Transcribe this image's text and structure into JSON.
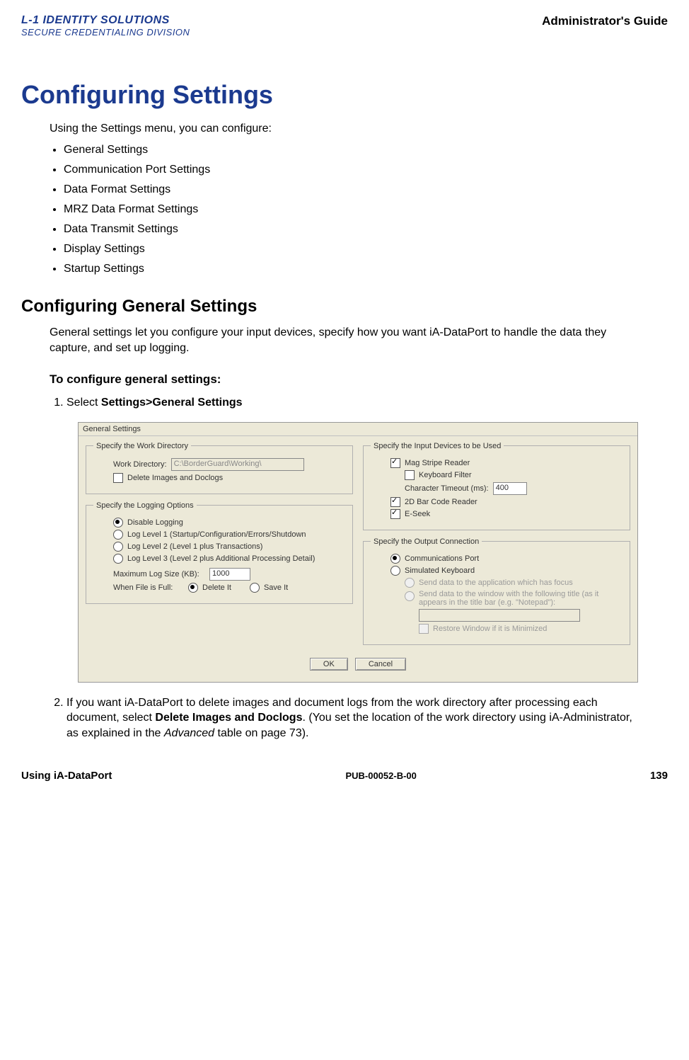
{
  "header": {
    "logo_line1": "L-1 IDENTITY SOLUTIONS",
    "logo_line2": "SECURE CREDENTIALING DIVISION",
    "guide": "Administrator's Guide"
  },
  "h1": "Configuring Settings",
  "intro": "Using the Settings menu, you can configure:",
  "bullets": [
    "General Settings",
    "Communication Port Settings",
    "Data Format Settings",
    "MRZ Data Format Settings",
    "Data Transmit Settings",
    "Display Settings",
    "Startup Settings"
  ],
  "h2": "Configuring General Settings",
  "para1": "General settings let you configure your input devices, specify how you want iA-DataPort to handle the data they capture, and set up logging.",
  "sub3": "To configure general settings:",
  "step1_pre": "Select ",
  "step1_bold": "Settings>General Settings",
  "step2_a": "If you want iA-DataPort to delete images and document logs from the work directory after processing each document, select ",
  "step2_bold": "Delete Images and Doclogs",
  "step2_b": ". (You set the location of the work directory using iA-Administrator, as explained in the ",
  "step2_italic": "Advanced",
  "step2_c": " table on page 73).",
  "dialog": {
    "title": "General Settings",
    "work_group": "Specify the Work Directory",
    "work_dir_label": "Work Directory:",
    "work_dir_value": "C:\\BorderGuard\\Working\\",
    "delete_images": "Delete Images and Doclogs",
    "input_group": "Specify the Input Devices to be Used",
    "mag_stripe": "Mag Stripe Reader",
    "keyboard_filter": "Keyboard Filter",
    "char_timeout_label": "Character Timeout (ms):",
    "char_timeout_value": "400",
    "barcode": "2D Bar Code Reader",
    "eseek": "E-Seek",
    "log_group": "Specify the Logging Options",
    "log_disable": "Disable Logging",
    "log1": "Log Level 1 (Startup/Configuration/Errors/Shutdown",
    "log2": "Log Level 2 (Level 1 plus Transactions)",
    "log3": "Log Level 3 (Level 2 plus Additional Processing Detail)",
    "max_log_label": "Maximum Log Size (KB):",
    "max_log_value": "1000",
    "when_full_label": "When File is Full:",
    "delete_it": "Delete It",
    "save_it": "Save It",
    "output_group": "Specify the Output Connection",
    "comm_port": "Communications Port",
    "sim_keyboard": "Simulated Keyboard",
    "send_focus": "Send data to the application which has focus",
    "send_title": "Send data to the window with the following title (as it appears in the title bar (e.g. \"Notepad\"):",
    "restore_window": "Restore Window if it is Minimized",
    "ok": "OK",
    "cancel": "Cancel"
  },
  "footer": {
    "left": "Using iA-DataPort",
    "center": "PUB-00052-B-00",
    "right": "139"
  }
}
